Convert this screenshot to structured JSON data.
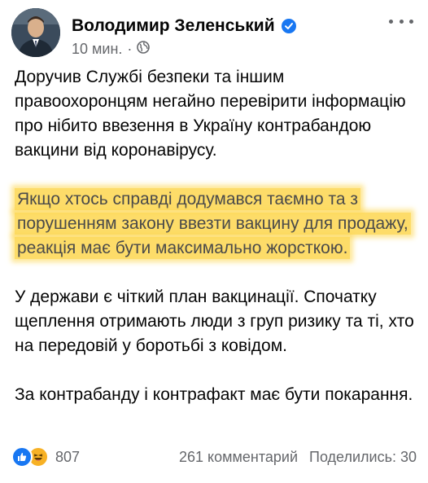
{
  "post": {
    "author": "Володимир Зеленський",
    "time": "10 мин.",
    "paragraphs": [
      {
        "text": "Доручив Службі безпеки та іншим правоохоронцям негайно перевірити інформацію про нібито ввезення в Україну контрабандою вакцини від коронавірусу.",
        "highlighted": false
      },
      {
        "text": "Якщо хтось справді додумався таємно та з порушенням закону ввезти вакцину для продажу, реакція має бути максимально жорсткою.",
        "highlighted": true
      },
      {
        "text": "У держави є чіткий план вакцинації. Спочатку щеплення отримають люди з груп ризику та ті, хто на передовій у боротьбі з ковідом.",
        "highlighted": false
      },
      {
        "text": "За контрабанду і контрафакт має бути покарання.",
        "highlighted": false
      }
    ],
    "highlight_color": "#fdd64f"
  },
  "footer": {
    "reaction_count": "807",
    "comments": "261 комментарий",
    "shares": "Поделились: 30"
  },
  "icons": {
    "verified": "verified-badge-icon",
    "privacy": "globe-icon",
    "reactions": [
      "like-icon",
      "haha-icon"
    ]
  }
}
